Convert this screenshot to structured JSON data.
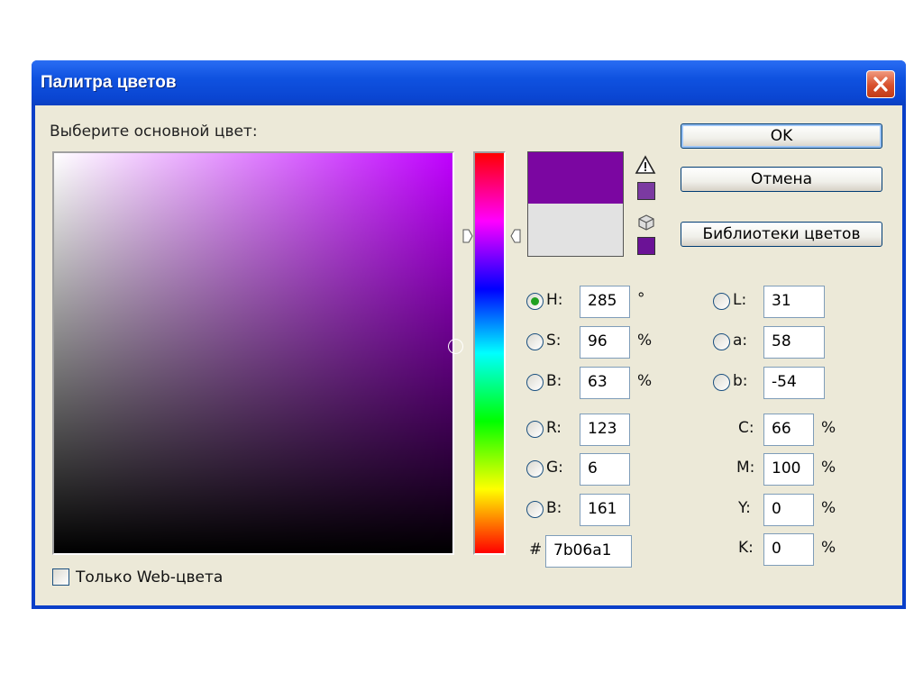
{
  "window": {
    "title": "Палитра цветов"
  },
  "picker": {
    "prompt": "Выберите основной цвет:",
    "web_only_label": "Только Web-цвета",
    "web_only_checked": false
  },
  "colors": {
    "new": "#7b06a1",
    "current": "#e2e2e2"
  },
  "buttons": {
    "ok": "OK",
    "cancel": "Отмена",
    "libraries": "Библиотеки цветов"
  },
  "hsb": {
    "h": {
      "label": "H:",
      "value": "285",
      "unit": "°"
    },
    "s": {
      "label": "S:",
      "value": "96",
      "unit": "%"
    },
    "b": {
      "label": "B:",
      "value": "63",
      "unit": "%"
    }
  },
  "rgb": {
    "r": {
      "label": "R:",
      "value": "123"
    },
    "g": {
      "label": "G:",
      "value": "6"
    },
    "b": {
      "label": "B:",
      "value": "161"
    }
  },
  "hex": {
    "label": "#",
    "value": "7b06a1"
  },
  "lab": {
    "l": {
      "label": "L:",
      "value": "31"
    },
    "a": {
      "label": "a:",
      "value": "58"
    },
    "b": {
      "label": "b:",
      "value": "-54"
    }
  },
  "cmyk": {
    "c": {
      "label": "C:",
      "value": "66",
      "unit": "%"
    },
    "m": {
      "label": "M:",
      "value": "100",
      "unit": "%"
    },
    "y": {
      "label": "Y:",
      "value": "0",
      "unit": "%"
    },
    "k": {
      "label": "K:",
      "value": "0",
      "unit": "%"
    }
  }
}
